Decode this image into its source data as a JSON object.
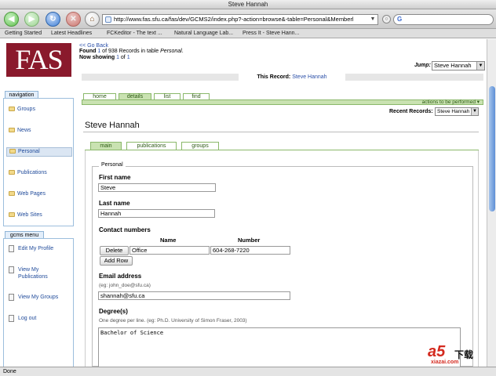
{
  "window": {
    "title": "Steve Hannah"
  },
  "toolbar": {
    "url": "http://www.fas.sfu.ca/fas/dev/GCMS2/index.php?-action=browse&-table=Personal&Memberl",
    "search_logo": "G",
    "icons": [
      "back-icon",
      "forward-icon",
      "reload-icon",
      "stop-icon",
      "home-icon",
      "go-icon"
    ]
  },
  "bookmarks": [
    "Getting Started",
    "Latest Headlines",
    "FCKeditor - The text ...",
    "Natural Language Lab...",
    "Press It - Steve Hann..."
  ],
  "header": {
    "logo": "FAS",
    "go_back": "<< Go Back",
    "found_prefix": "Found ",
    "found_num": "1",
    "found_mid": " of ",
    "found_total": "938",
    "found_suffix": " Records in table ",
    "found_table": "Personal",
    "found_end": ".",
    "showing_prefix": "Now showing ",
    "showing_num": "1",
    "showing_mid": " of ",
    "showing_total": "1",
    "jump_label": "Jump:",
    "jump_value": "Steve Hannah",
    "record_label": "This Record:",
    "record_value": "Steve Hannah"
  },
  "sidebar": {
    "nav_title": "navigation",
    "items": [
      {
        "label": "Groups",
        "active": false
      },
      {
        "label": "News",
        "active": false
      },
      {
        "label": "Personal",
        "active": true
      },
      {
        "label": "Publications",
        "active": false
      },
      {
        "label": "Web Pages",
        "active": false
      },
      {
        "label": "Web Sites",
        "active": false
      }
    ],
    "gcms_title": "gcms menu",
    "gcms_items": [
      {
        "line1": "Edit My Profile",
        "line2": ""
      },
      {
        "line1": "View My",
        "line2": "Publications"
      },
      {
        "line1": "View My Groups",
        "line2": ""
      },
      {
        "line1": "Log out",
        "line2": ""
      }
    ]
  },
  "main": {
    "tabs": [
      "home",
      "details",
      "list",
      "find"
    ],
    "active_tab": "details",
    "actions": "actions to be performed ▾",
    "recent_label": "Recent Records:",
    "recent_value": "Steve Hannah",
    "person_title": "Steve Hannah",
    "subtabs": [
      "main",
      "publications",
      "groups"
    ],
    "active_subtab": "main",
    "form": {
      "legend": "Personal",
      "first_name_label": "First name",
      "first_name_value": "Steve",
      "last_name_label": "Last name",
      "last_name_value": "Hannah",
      "contact_label": "Contact numbers",
      "contact_col_name": "Name",
      "contact_col_number": "Number",
      "delete_label": "Delete",
      "contact_name_value": "Office",
      "contact_number_value": "604-268-7220",
      "add_row_label": "Add Row",
      "email_label": "Email address",
      "email_hint": "(eg: john_doe@sfu.ca)",
      "email_value": "shannah@sfu.ca",
      "degree_label": "Degree(s)",
      "degree_hint": "One degree per line. (eg: Ph.D. University of Simon Fraser, 2003)",
      "degree_value": "Bachelor of Science"
    }
  },
  "status": {
    "text": "Done"
  },
  "watermark": {
    "mark": "a5",
    "cn": "下载",
    "url": "xiazai.com"
  }
}
